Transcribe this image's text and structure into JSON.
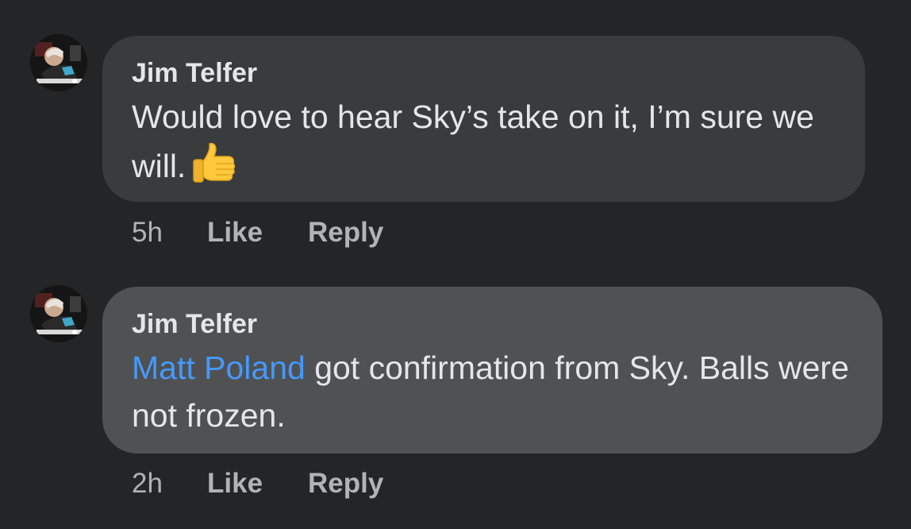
{
  "comments": [
    {
      "author": "Jim Telfer",
      "text": "Would love to hear Sky’s take on it, I’m sure we will.",
      "emoji": "thumbs-up",
      "time": "5h",
      "like_label": "Like",
      "reply_label": "Reply"
    },
    {
      "author": "Jim Telfer",
      "mention": "Matt Poland",
      "text": " got confirmation from Sky. Balls were not frozen.",
      "time": "2h",
      "like_label": "Like",
      "reply_label": "Reply"
    }
  ],
  "colors": {
    "background": "#242526",
    "bubble_1": "#3a3b3c",
    "bubble_2": "#505152",
    "mention": "#4599ff",
    "text": "#e4e6eb",
    "muted": "#b0b3b8"
  }
}
